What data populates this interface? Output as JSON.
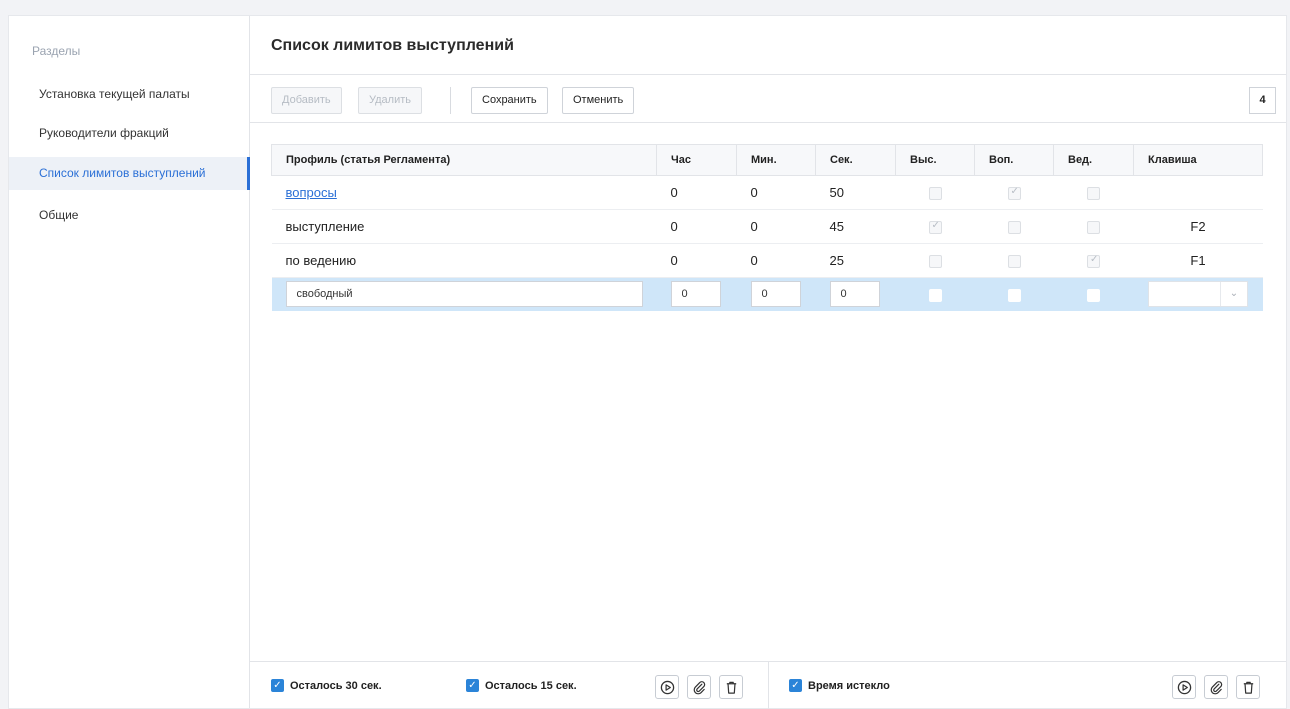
{
  "sidebar": {
    "title": "Разделы",
    "items": [
      {
        "label": "Установка текущей палаты"
      },
      {
        "label": "Руководители фракций"
      },
      {
        "label": "Список лимитов выступлений"
      },
      {
        "label": "Общие"
      }
    ]
  },
  "page": {
    "title": "Список лимитов выступлений"
  },
  "toolbar": {
    "add_label": "Добавить",
    "delete_label": "Удалить",
    "save_label": "Сохранить",
    "cancel_label": "Отменить",
    "count": "4"
  },
  "table": {
    "headers": [
      "Профиль (статья Регламента)",
      "Час",
      "Мин.",
      "Сек.",
      "Выс.",
      "Воп.",
      "Вед.",
      "Клавиша"
    ],
    "rows": [
      {
        "profile": "вопросы",
        "hour": "0",
        "min": "0",
        "sec": "50",
        "vys": false,
        "vop": true,
        "ved": false,
        "key": ""
      },
      {
        "profile": "выступление",
        "hour": "0",
        "min": "0",
        "sec": "45",
        "vys": true,
        "vop": false,
        "ved": false,
        "key": "F2"
      },
      {
        "profile": "по ведению",
        "hour": "0",
        "min": "0",
        "sec": "25",
        "vys": false,
        "vop": false,
        "ved": true,
        "key": "F1"
      }
    ],
    "edit_row": {
      "profile": "свободный",
      "hour": "0",
      "min": "0",
      "sec": "0",
      "key": ""
    }
  },
  "footer": {
    "left_check_1": "Осталось 30 сек.",
    "left_check_2": "Осталось 15 сек.",
    "right_check": "Время истекло"
  },
  "colors": {
    "accent": "#2a6fd6",
    "checkbox_on": "#2b84d8",
    "edit_row": "#cfe6f9"
  }
}
